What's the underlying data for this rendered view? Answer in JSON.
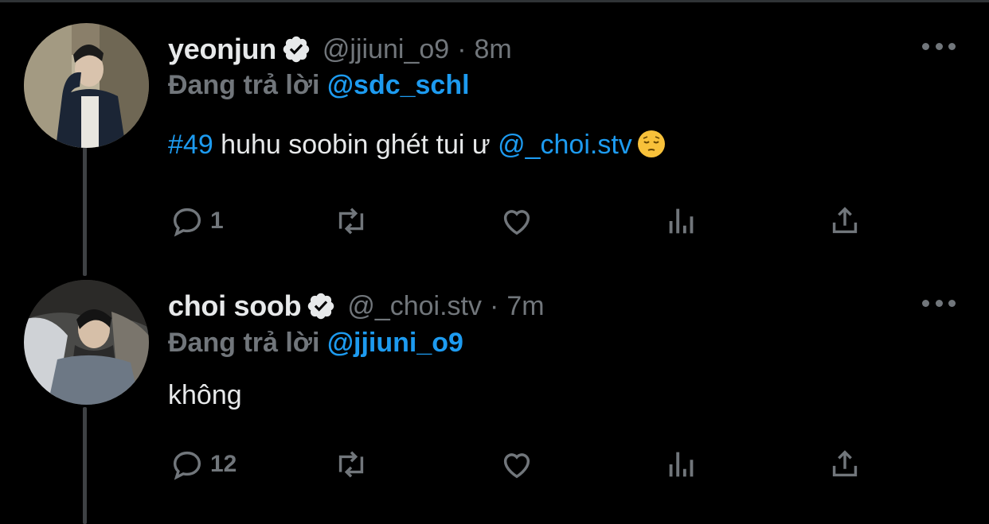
{
  "tweets": [
    {
      "name": "yeonjun",
      "handle": "@jjiuni_o9",
      "separator": "·",
      "time": "8m",
      "reply_label": "Đang trả lời",
      "reply_to": "@sdc_schl",
      "body": {
        "hashtag": "#49",
        "text": " huhu soobin ghét tui ư ",
        "mention": "@_choi.stv",
        "emoji": "pensive-face-emoji"
      },
      "actions": {
        "reply_count": "1",
        "retweet_count": "",
        "like_count": ""
      }
    },
    {
      "name": "choi soob",
      "handle": "@_choi.stv",
      "separator": "·",
      "time": "7m",
      "reply_label": "Đang trả lời",
      "reply_to": "@jjiuni_o9",
      "body": {
        "text": "không"
      },
      "actions": {
        "reply_count": "12",
        "retweet_count": "",
        "like_count": ""
      }
    }
  ],
  "icons": {
    "verified": "verified-badge-icon",
    "more": "more-options-icon",
    "reply": "reply-icon",
    "retweet": "retweet-icon",
    "like": "like-icon",
    "analytics": "analytics-icon",
    "share": "share-icon"
  },
  "colors": {
    "background": "#000000",
    "primary_text": "#e7e9ea",
    "secondary_text": "#71767b",
    "link": "#1d9bf0",
    "thread_line": "#3e4144"
  }
}
